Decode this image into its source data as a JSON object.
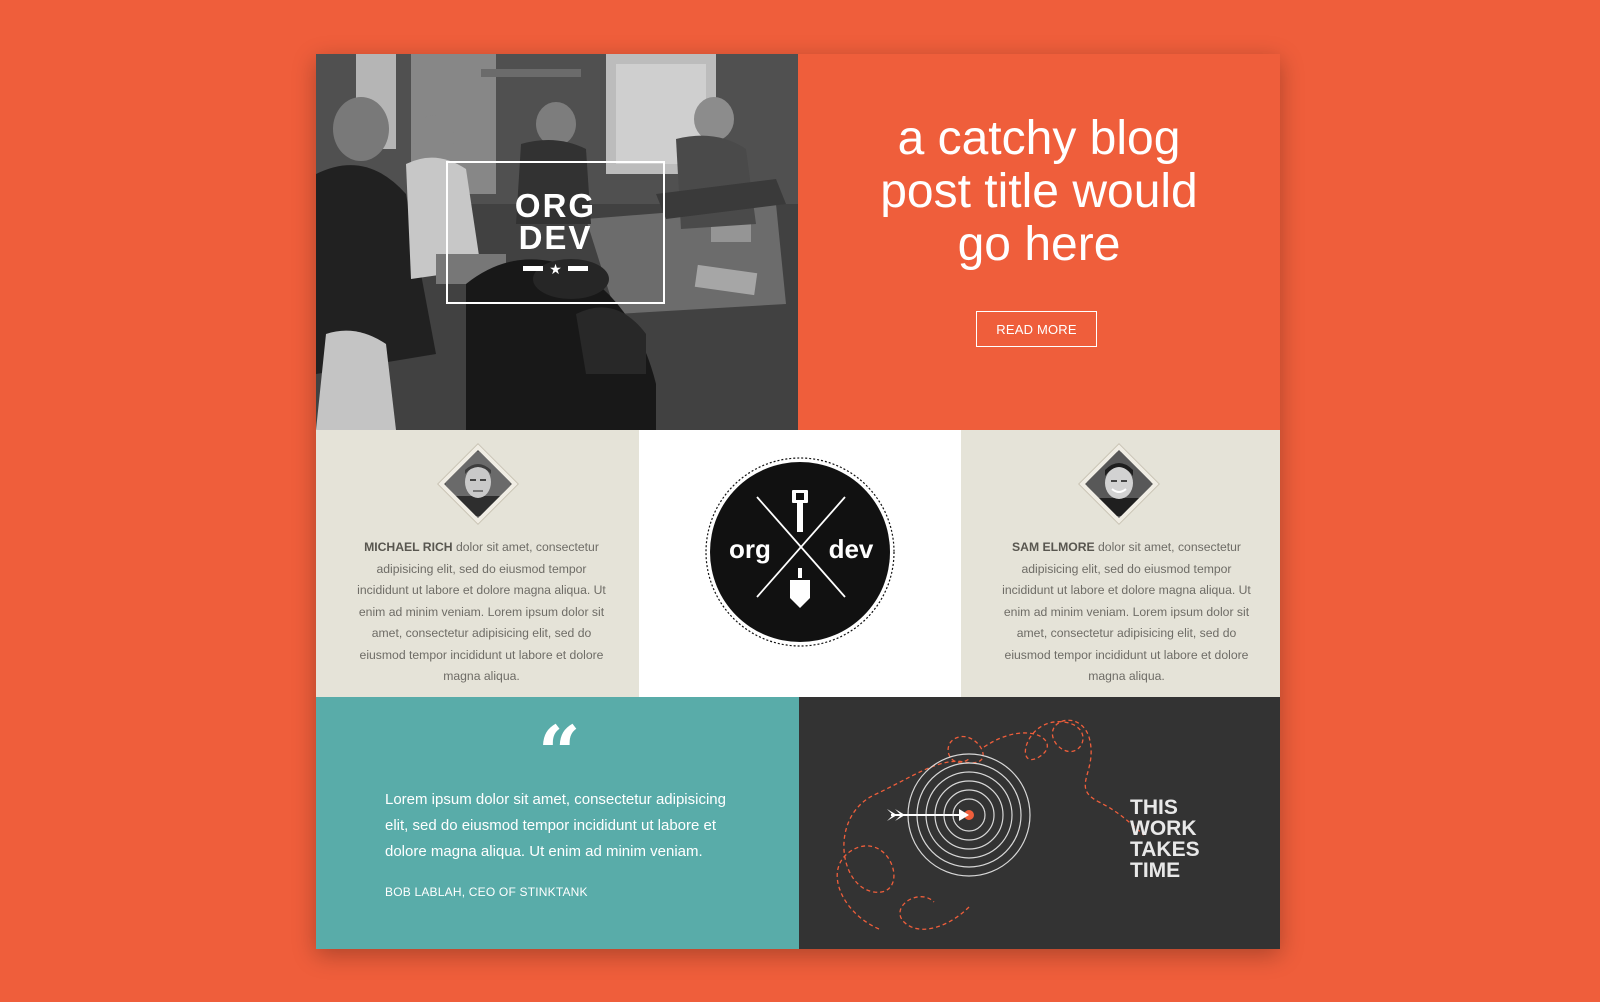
{
  "brand": {
    "line1": "ORG",
    "line2": "DEV"
  },
  "hero": {
    "title": "a catchy blog\npost title would\ngo here",
    "button_label": "READ MORE"
  },
  "bios": [
    {
      "name": "MICHAEL RICH",
      "text": " dolor sit amet, consectetur adipisicing elit, sed do eiusmod tempor incididunt ut labore et dolore magna aliqua. Ut enim ad minim veniam. Lorem ipsum dolor sit amet, consectetur adipisicing elit, sed do eiusmod tempor incididunt ut labore et dolore magna aliqua."
    },
    {
      "name": "SAM ELMORE",
      "text": " dolor sit amet, consectetur adipisicing elit, sed do eiusmod tempor incididunt ut labore et dolore magna aliqua. Ut enim ad minim veniam. Lorem ipsum dolor sit amet, consectetur adipisicing elit, sed do eiusmod tempor incididunt ut labore et dolore magna aliqua."
    }
  ],
  "logo": {
    "left": "org",
    "right": "dev"
  },
  "quote": {
    "mark": "“",
    "text": "Lorem ipsum dolor sit amet, consectetur adipisicing elit, sed do eiusmod tempor incididunt ut labore et dolore magna aliqua. Ut enim ad minim veniam.",
    "cite": "BOB LABLAH, CEO OF STINKTANK"
  },
  "work": {
    "lines": [
      "THIS",
      "WORK",
      "TAKES",
      "TIME"
    ]
  },
  "colors": {
    "background": "#ef5e3b",
    "accent_orange": "#ef5e3b",
    "teal": "#59aca9",
    "beige": "#e5e3d8",
    "dark": "#333333"
  },
  "icons": [
    "star-icon",
    "quote-icon",
    "shovel-icon",
    "target-icon",
    "arrow-icon"
  ]
}
